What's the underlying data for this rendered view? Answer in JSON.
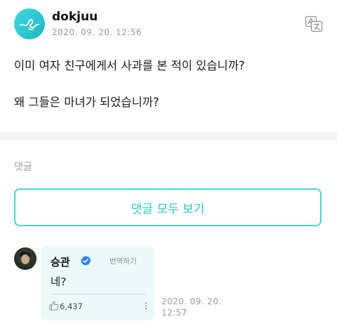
{
  "post": {
    "author": "dokjuu",
    "date": "2020. 09. 20. 12:56",
    "paragraphs": [
      "이미 여자 친구에게서 사과를 본 적이 있습니까?",
      "왜 그들은 마녀가 되었습니까?"
    ]
  },
  "comments_section": {
    "label": "댓글",
    "view_all_label": "댓글 모두 보기"
  },
  "comment": {
    "author": "승관",
    "translate_label": "번역하기",
    "text": "네?",
    "likes": "6,437",
    "date_line1": "2020. 09. 20.",
    "date_line2": "12:57"
  },
  "colors": {
    "accent": "#2ec9c1",
    "button_border": "#49d4cc",
    "bubble_bg": "#eafafa",
    "verified": "#2f80ed"
  },
  "icons": {
    "translate": "translate-icon",
    "verified": "verified-badge-icon",
    "like": "thumbs-up-icon",
    "more": "more-vertical-icon"
  }
}
